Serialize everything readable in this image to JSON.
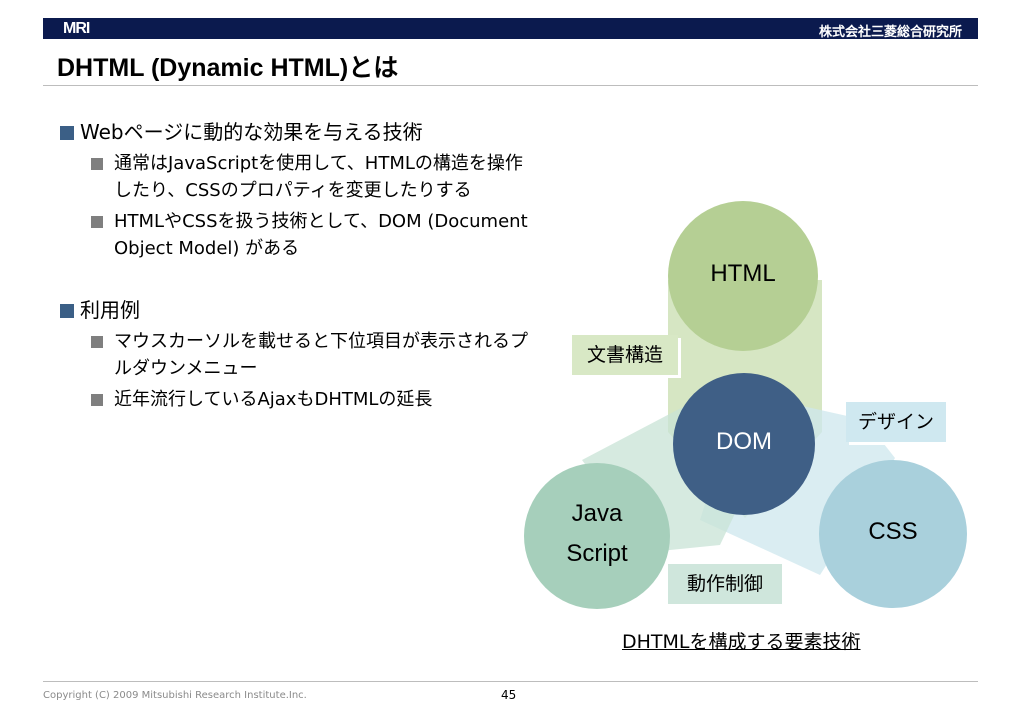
{
  "header": {
    "logo_text": "MRI",
    "company": "株式会社三菱総合研究所",
    "title": "DHTML (Dynamic HTML)とは",
    "bar_color": "#0b1a4e"
  },
  "bullets": {
    "b1": {
      "text": "Webページに動的な効果を与える技術",
      "sub": [
        "通常はJavaScriptを使用して、HTMLの構造を操作したり、CSSのプロパティを変更したりする",
        "HTMLやCSSを扱う技術として、DOM (Document Object Model) がある"
      ]
    },
    "b2": {
      "text": "利用例",
      "sub": [
        "マウスカーソルを載せると下位項目が表示されるプルダウンメニュー",
        "近年流行しているAjaxもDHTMLの延長"
      ]
    }
  },
  "diagram": {
    "circles": {
      "html": "HTML",
      "dom": "DOM",
      "css": "CSS",
      "js_line1": "Java",
      "js_line2": "Script"
    },
    "labels": {
      "document_structure": "文書構造",
      "design": "デザイン",
      "behavior_control": "動作制御"
    },
    "caption": "DHTMLを構成する要素技術",
    "colors": {
      "html": "#b5cf94",
      "dom": "#3f5f86",
      "css": "#a9d0dc",
      "js": "#a6cfbb",
      "html_band": "#cfe2b9",
      "css_band": "#cde7ee",
      "js_band": "#c8e3d5",
      "label_green": "#d8e8c5",
      "label_blue": "#cfe8f0",
      "label_teal": "#cfe6dc"
    }
  },
  "footer": {
    "copyright": "Copyright (C) 2009 Mitsubishi Research Institute.Inc.",
    "page": "45"
  }
}
